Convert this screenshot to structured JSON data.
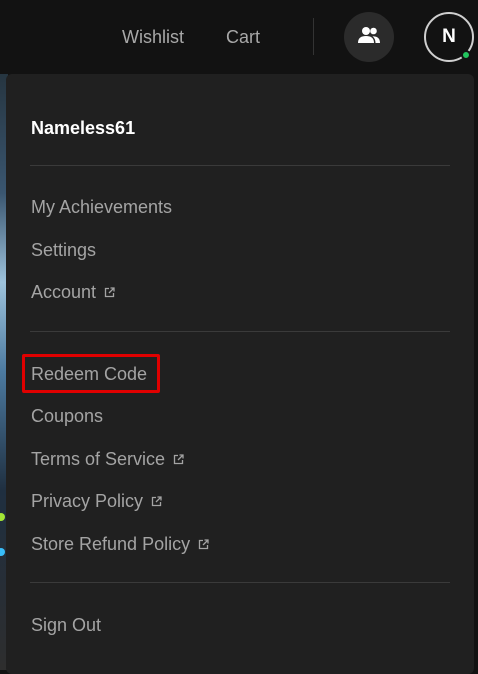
{
  "header": {
    "wishlist_label": "Wishlist",
    "cart_label": "Cart",
    "friends_icon": "friends-icon",
    "avatar_initial": "N",
    "online_status_color": "#22c55e"
  },
  "menu": {
    "username": "Nameless61",
    "section1": [
      {
        "label": "My Achievements",
        "external": false
      },
      {
        "label": "Settings",
        "external": false
      },
      {
        "label": "Account",
        "external": true
      }
    ],
    "section2": [
      {
        "label": "Redeem Code",
        "external": false,
        "highlighted": true
      },
      {
        "label": "Coupons",
        "external": false
      },
      {
        "label": "Terms of Service",
        "external": true
      },
      {
        "label": "Privacy Policy",
        "external": true
      },
      {
        "label": "Store Refund Policy",
        "external": true
      }
    ],
    "sign_out_label": "Sign Out"
  },
  "colors": {
    "background": "#121212",
    "menu_background": "#202020",
    "highlight_border": "#e00000"
  }
}
